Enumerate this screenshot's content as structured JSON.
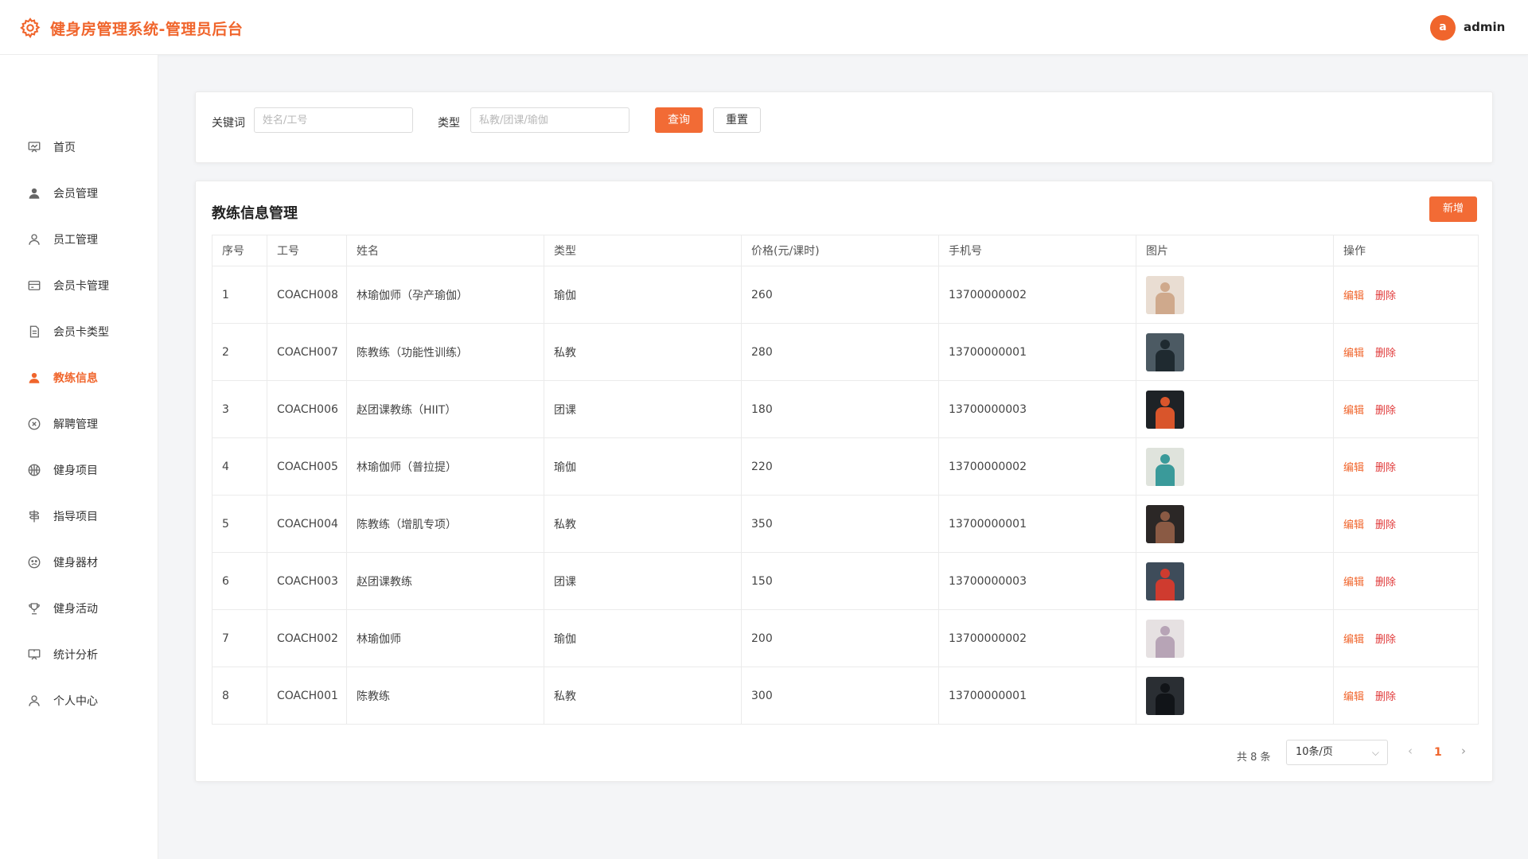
{
  "header": {
    "title": "健身房管理系统-管理员后台",
    "avatar_letter": "a",
    "username": "admin",
    "brand_color": "#f0652c"
  },
  "sidebar": {
    "items": [
      {
        "label": "首页",
        "icon": "dashboard-icon"
      },
      {
        "label": "会员管理",
        "icon": "user-filled-icon"
      },
      {
        "label": "员工管理",
        "icon": "user-icon"
      },
      {
        "label": "会员卡管理",
        "icon": "card-icon"
      },
      {
        "label": "会员卡类型",
        "icon": "document-icon"
      },
      {
        "label": "教练信息",
        "icon": "coach-icon",
        "active": true
      },
      {
        "label": "解聘管理",
        "icon": "circle-close-icon"
      },
      {
        "label": "健身项目",
        "icon": "basketball-icon"
      },
      {
        "label": "指导项目",
        "icon": "signpost-icon"
      },
      {
        "label": "健身器材",
        "icon": "equipment-icon"
      },
      {
        "label": "健身活动",
        "icon": "trophy-icon"
      },
      {
        "label": "统计分析",
        "icon": "presentation-icon"
      },
      {
        "label": "个人中心",
        "icon": "profile-icon"
      }
    ]
  },
  "search": {
    "keyword_label": "关键词",
    "keyword_placeholder": "姓名/工号",
    "keyword_value": "",
    "type_label": "类型",
    "type_placeholder": "私教/团课/瑜伽",
    "type_value": "",
    "query_label": "查询",
    "reset_label": "重置"
  },
  "table": {
    "title": "教练信息管理",
    "add_label": "新增",
    "columns": [
      "序号",
      "工号",
      "姓名",
      "类型",
      "价格(元/课时)",
      "手机号",
      "图片",
      "操作"
    ],
    "edit_label": "编辑",
    "delete_label": "删除",
    "rows": [
      {
        "index": "1",
        "code": "COACH008",
        "name": "林瑜伽师（孕产瑜伽）",
        "type": "瑜伽",
        "price": "260",
        "phone": "13700000002",
        "photo_bg": "#e9ddd2",
        "photo_fg": "#cfa98c"
      },
      {
        "index": "2",
        "code": "COACH007",
        "name": "陈教练（功能性训练）",
        "type": "私教",
        "price": "280",
        "phone": "13700000001",
        "photo_bg": "#4c5a63",
        "photo_fg": "#1f2a30"
      },
      {
        "index": "3",
        "code": "COACH006",
        "name": "赵团课教练（HIIT）",
        "type": "团课",
        "price": "180",
        "phone": "13700000003",
        "photo_bg": "#1e2226",
        "photo_fg": "#d9552b"
      },
      {
        "index": "4",
        "code": "COACH005",
        "name": "林瑜伽师（普拉提）",
        "type": "瑜伽",
        "price": "220",
        "phone": "13700000002",
        "photo_bg": "#dfe3dc",
        "photo_fg": "#3a9a9a"
      },
      {
        "index": "5",
        "code": "COACH004",
        "name": "陈教练（增肌专项）",
        "type": "私教",
        "price": "350",
        "phone": "13700000001",
        "photo_bg": "#2b2726",
        "photo_fg": "#8a5a44"
      },
      {
        "index": "6",
        "code": "COACH003",
        "name": "赵团课教练",
        "type": "团课",
        "price": "150",
        "phone": "13700000003",
        "photo_bg": "#3e4c5a",
        "photo_fg": "#cf3b2f"
      },
      {
        "index": "7",
        "code": "COACH002",
        "name": "林瑜伽师",
        "type": "瑜伽",
        "price": "200",
        "phone": "13700000002",
        "photo_bg": "#e6e1e2",
        "photo_fg": "#b7a4b6"
      },
      {
        "index": "8",
        "code": "COACH001",
        "name": "陈教练",
        "type": "私教",
        "price": "300",
        "phone": "13700000001",
        "photo_bg": "#2a2e33",
        "photo_fg": "#111418"
      }
    ]
  },
  "pagination": {
    "total_text": "共 8 条",
    "page_size": "10条/页",
    "current_page": "1"
  }
}
